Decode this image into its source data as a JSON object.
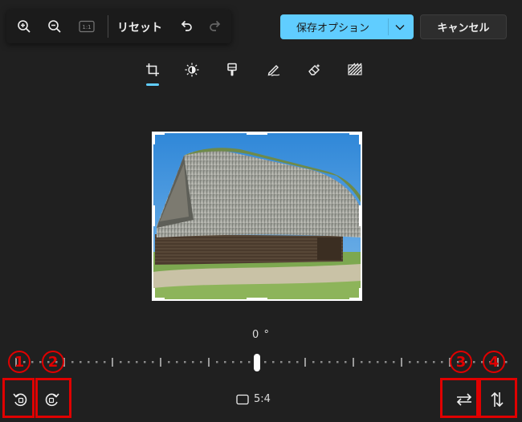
{
  "toolbar": {
    "zoom_in_icon": "zoom-in-icon",
    "zoom_out_icon": "zoom-out-icon",
    "actual_size_icon": "actual-size-icon",
    "actual_size_label": "1:1",
    "reset_label": "リセット",
    "undo_icon": "undo-icon",
    "redo_icon": "redo-icon"
  },
  "header": {
    "save_label": "保存オプション",
    "cancel_label": "キャンセル"
  },
  "tools": [
    "crop",
    "adjustment",
    "filter",
    "markup",
    "erase",
    "background-blur"
  ],
  "active_tool": "crop",
  "rotation": {
    "angle_label": "0 °"
  },
  "aspect_ratio": {
    "label": "5:4"
  },
  "annotations": [
    "1",
    "2",
    "3",
    "4"
  ],
  "colors": {
    "accent": "#60cdff",
    "background": "#202020",
    "annotation_red": "#e00000"
  }
}
